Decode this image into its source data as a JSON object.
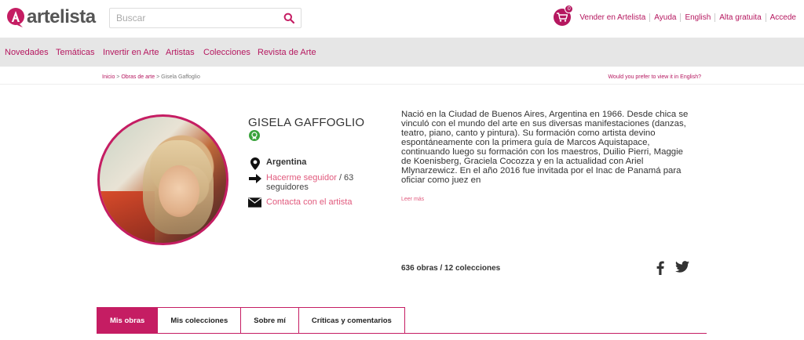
{
  "header": {
    "logo_text": "artelista",
    "search_placeholder": "Buscar",
    "cart_count": "0",
    "links": [
      "Vender en Artelista",
      "Ayuda",
      "English",
      "Alta gratuita",
      "Accede"
    ]
  },
  "categories": [
    "Novedades",
    "Temáticas",
    "Invertir en Arte",
    "Artistas",
    "Colecciones",
    "Revista de Arte"
  ],
  "breadcrumb": {
    "items": [
      "Inicio",
      "Obras de arte"
    ],
    "current": "Gisela Gaffoglio",
    "separator": ">"
  },
  "english_prompt": "Would you prefer to view it in English?",
  "artist": {
    "name": "GISELA GAFFOGLIO",
    "country": "Argentina",
    "follow_label": "Hacerme seguidor",
    "followers_text": "/ 63",
    "followers_label": "seguidores",
    "contact_label": "Contacta con el artista"
  },
  "bio": {
    "text": "Nació en la Ciudad de Buenos Aires, Argentina en 1966. Desde chica se vinculó con el mundo del arte en sus diversas manifestaciones (danzas, teatro, piano, canto y pintura). Su formación como artista devino espontáneamente con la primera guía de Marcos Aquistapace, continuando luego su formación con los maestros, Duilio Pierri, Maggie de Koenisberg, Graciela Cocozza y en la actualidad con Ariel Mlynarzewicz. En el año 2016 fue invitada por el Inac de Panamá para oficiar como juez en",
    "more_label": "Leer más"
  },
  "stats": {
    "works": "636 obras",
    "collections": "/ 12 colecciones"
  },
  "tabs": [
    "Mis obras",
    "Mis colecciones",
    "Sobre mí",
    "Críticas y comentarios"
  ],
  "colors": {
    "brand": "#c51d63",
    "link": "#b5175f",
    "soft_link": "#e15a7d"
  },
  "icons": [
    "logo-mark-icon",
    "search-icon",
    "cart-icon",
    "verified-icon",
    "location-pin-icon",
    "arrow-right-icon",
    "envelope-icon",
    "facebook-icon",
    "twitter-icon"
  ]
}
